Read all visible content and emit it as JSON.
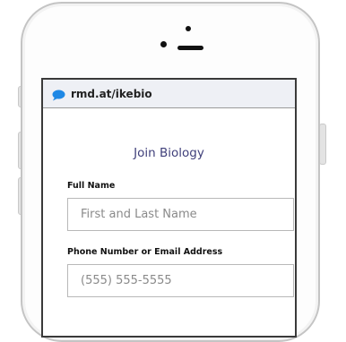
{
  "browser": {
    "url": "rmd.at/ikebio",
    "accent_color": "#1e88e5"
  },
  "form": {
    "title": "Join Biology",
    "full_name": {
      "label": "Full Name",
      "placeholder": "First and Last Name"
    },
    "contact": {
      "label": "Phone Number or Email Address",
      "placeholder": "(555) 555-5555"
    }
  }
}
